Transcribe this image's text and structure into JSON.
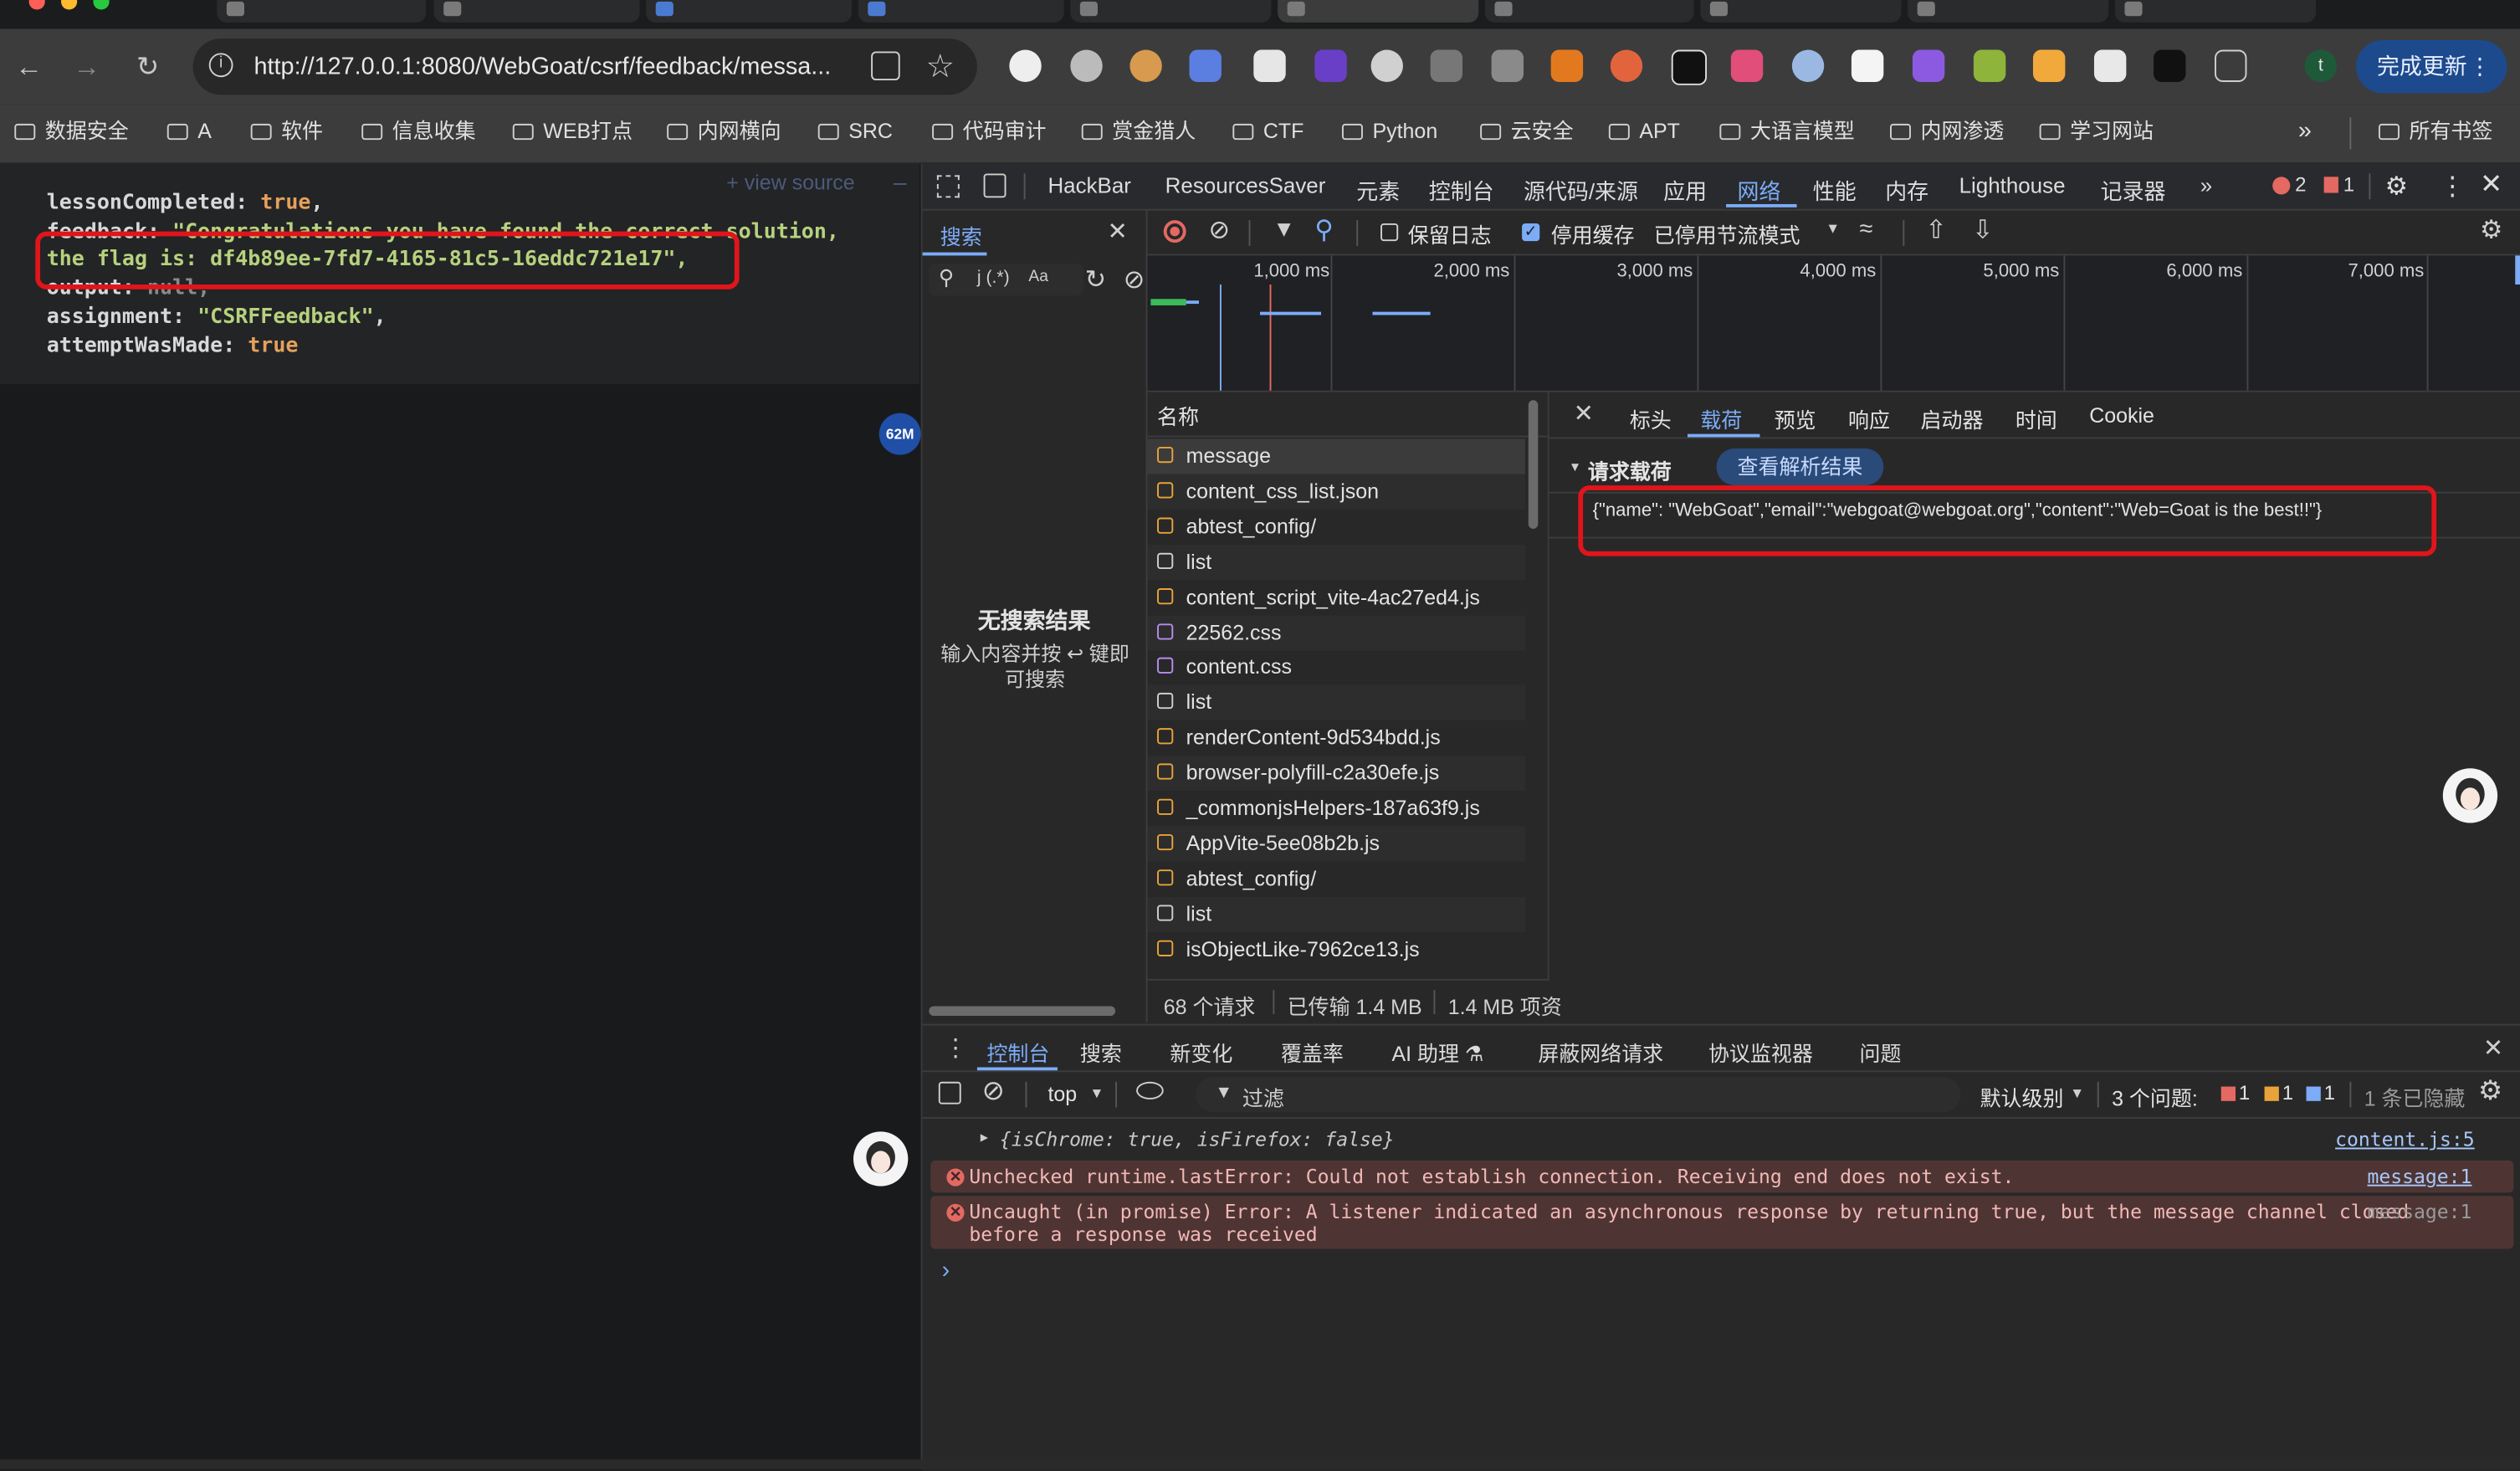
{
  "browser": {
    "url": "http://127.0.0.1:8080/WebGoat/csrf/feedback/messa...",
    "update_button": "完成更新",
    "bookmarks": [
      "数据安全",
      "A",
      "软件",
      "信息收集",
      "WEB打点",
      "内网横向",
      "SRC",
      "代码审计",
      "赏金猎人",
      "CTF",
      "Python",
      "云安全",
      "APT",
      "大语言模型",
      "内网渗透",
      "学习网站"
    ],
    "all_bookmarks": "所有书签"
  },
  "page": {
    "view_source": "+ view source",
    "json": {
      "lessonCompleted_key": "lessonCompleted:",
      "lessonCompleted_val": "true",
      "feedback_key": "feedback:",
      "feedback_val": "\"Congratulations you have found the correct solution,",
      "flag_line": "the flag is: df4b89ee-7fd7-4165-81c5-16eddc721e17\",",
      "output_key": "output:",
      "output_val": "null,",
      "assignment_key": "assignment:",
      "assignment_val": "\"CSRFFeedback\"",
      "attempt_key": "attemptWasMade:",
      "attempt_val": "true"
    },
    "memory_badge": "62M"
  },
  "devtools": {
    "tabs": [
      "HackBar",
      "ResourcesSaver",
      "元素",
      "控制台",
      "源代码/来源",
      "应用",
      "网络",
      "性能",
      "内存",
      "Lighthouse",
      "记录器"
    ],
    "errors_count": "2",
    "warnings_count": "1",
    "search": {
      "title": "搜索",
      "no_results": "无搜索结果",
      "hint": "输入内容并按 ↩ 键即可搜索"
    },
    "network_toolbar": {
      "preserve_log": "保留日志",
      "disable_cache": "停用缓存",
      "throttling": "已停用节流模式"
    },
    "timeline_ticks": [
      "1,000 ms",
      "2,000 ms",
      "3,000 ms",
      "4,000 ms",
      "5,000 ms",
      "6,000 ms",
      "7,000 ms"
    ],
    "name_header": "名称",
    "requests": [
      {
        "name": "message",
        "icon": "json"
      },
      {
        "name": "content_css_list.json",
        "icon": "json"
      },
      {
        "name": "abtest_config/",
        "icon": "json"
      },
      {
        "name": "list",
        "icon": "doc"
      },
      {
        "name": "content_script_vite-4ac27ed4.js",
        "icon": "script"
      },
      {
        "name": "22562.css",
        "icon": "css"
      },
      {
        "name": "content.css",
        "icon": "css"
      },
      {
        "name": "list",
        "icon": "doc"
      },
      {
        "name": "renderContent-9d534bdd.js",
        "icon": "script"
      },
      {
        "name": "browser-polyfill-c2a30efe.js",
        "icon": "script"
      },
      {
        "name": "_commonjsHelpers-187a63f9.js",
        "icon": "script"
      },
      {
        "name": "AppVite-5ee08b2b.js",
        "icon": "script"
      },
      {
        "name": "abtest_config/",
        "icon": "json"
      },
      {
        "name": "list",
        "icon": "doc"
      },
      {
        "name": "isObjectLike-7962ce13.js",
        "icon": "script"
      }
    ],
    "detail_tabs": [
      "标头",
      "载荷",
      "预览",
      "响应",
      "启动器",
      "时间",
      "Cookie"
    ],
    "payload_section": "请求载荷",
    "view_parsed": "查看解析结果",
    "payload": "{\"name\": \"WebGoat\",\"email\":\"webgoat@webgoat.org\",\"content\":\"Web=Goat is the best!!\"}",
    "status": {
      "requests": "68 个请求",
      "transferred": "已传输 1.4 MB",
      "resources": "1.4 MB 项资"
    },
    "console_tabs": [
      "控制台",
      "搜索",
      "新变化",
      "覆盖率",
      "AI 助理 ⚗",
      "屏蔽网络请求",
      "协议监视器",
      "问题"
    ],
    "console_toolbar": {
      "context": "top",
      "filter": "过滤",
      "level": "默认级别",
      "issues": "3 个问题:",
      "issue_counts": [
        "1",
        "1",
        "1"
      ],
      "hidden": "1 条已隐藏"
    },
    "console_lines": {
      "obj_line": "{isChrome: true, isFirefox: false}",
      "obj_src": "content.js:5",
      "err1": "Unchecked runtime.lastError: Could not establish connection. Receiving end does not exist.",
      "err1_src": "message:1",
      "err2a": "Uncaught (in promise) Error: A listener indicated an asynchronous response by returning true, but the message channel closed",
      "err2b": "before a response was received",
      "err2_src": "message:1",
      "prompt": "›"
    }
  },
  "colors": {
    "accent": "#7cacf8",
    "highlight_red": "#e0151b",
    "error_bg": "#4e3534"
  }
}
